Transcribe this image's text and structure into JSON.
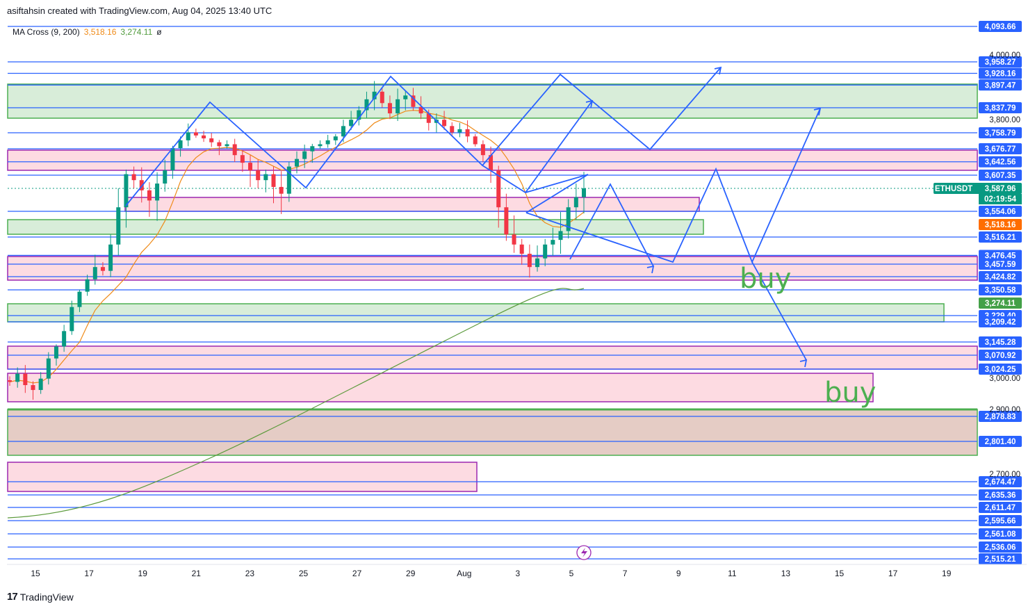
{
  "header": {
    "title": "asiftahsin created with TradingView.com, Aug 04, 2025 13:40 UTC"
  },
  "indicator": {
    "name": "MA Cross (9, 200)",
    "ma_fast": "3,518.16",
    "ma_slow": "3,274.11",
    "extra": "ø"
  },
  "brand": {
    "logo": "17",
    "name": "TradingView"
  },
  "colors": {
    "blue_line": "#2962ff",
    "green_zone": "#c8e6c9",
    "pink_zone": "#f8bbd0",
    "up": "#089981",
    "down": "#f23645",
    "ma_fast": "#ef8a17",
    "ma_slow": "#5b9a3b",
    "annotation": "#4caf50"
  },
  "icons": [
    "lightning-icon",
    "tradingview-logo-icon"
  ],
  "chart_data": {
    "type": "candlestick",
    "symbol": "ETHUSDT",
    "current_price": "3,587.96",
    "countdown": "02:19:54",
    "ma_fast_label": "3,518.16",
    "ma_slow_label": "3,274.11",
    "ylim": [
      2515.21,
      4093.66
    ],
    "x_ticks": [
      "15",
      "17",
      "19",
      "21",
      "23",
      "25",
      "27",
      "29",
      "Aug",
      "3",
      "5",
      "7",
      "9",
      "11",
      "13",
      "15",
      "17",
      "19"
    ],
    "y_static_ticks": [
      "4,000.00",
      "3,800.00",
      "3,000.00",
      "2,900.00",
      "2,700.00"
    ],
    "horizontal_levels": [
      {
        "label": "4,093.66",
        "value": 4093.66
      },
      {
        "label": "3,958.27",
        "value": 3958.27
      },
      {
        "label": "3,928.16",
        "value": 3928.16
      },
      {
        "label": "3,897.47",
        "value": 3897.47
      },
      {
        "label": "3,837.79",
        "value": 3837.79
      },
      {
        "label": "3,758.79",
        "value": 3758.79
      },
      {
        "label": "3,676.77",
        "value": 3676.77
      },
      {
        "label": "3,642.56",
        "value": 3642.56
      },
      {
        "label": "3,607.35",
        "value": 3607.35
      },
      {
        "label": "3,554.06",
        "value": 3554.06
      },
      {
        "label": "3,516.21",
        "value": 3516.21
      },
      {
        "label": "3,476.45",
        "value": 3476.45
      },
      {
        "label": "3,457.59",
        "value": 3457.59
      },
      {
        "label": "3,424.82",
        "value": 3424.82
      },
      {
        "label": "3,350.58",
        "value": 3350.58
      },
      {
        "label": "3,229.40",
        "value": 3229.4
      },
      {
        "label": "3,209.42",
        "value": 3209.42
      },
      {
        "label": "3,145.28",
        "value": 3145.28
      },
      {
        "label": "3,070.92",
        "value": 3070.92
      },
      {
        "label": "3,024.25",
        "value": 3024.25
      },
      {
        "label": "2,878.83",
        "value": 2878.83
      },
      {
        "label": "2,801.40",
        "value": 2801.4
      },
      {
        "label": "2,674.47",
        "value": 2674.47
      },
      {
        "label": "2,635.36",
        "value": 2635.36
      },
      {
        "label": "2,611.47",
        "value": 2611.47
      },
      {
        "label": "2,595.66",
        "value": 2595.66
      },
      {
        "label": "2,561.08",
        "value": 2561.08
      },
      {
        "label": "2,536.06",
        "value": 2536.06
      },
      {
        "label": "2,515.21",
        "value": 2515.21
      }
    ],
    "annotations": [
      "buy",
      "buy"
    ]
  }
}
